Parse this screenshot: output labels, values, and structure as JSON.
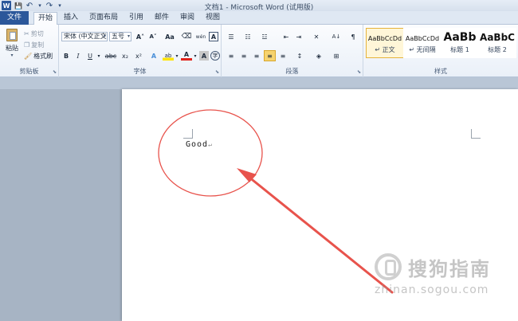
{
  "window": {
    "title": "文档1 - Microsoft Word (试用版)",
    "qat": {
      "logo": "W",
      "save": "💾",
      "undo": "↶",
      "redo": "↷",
      "customize": "▾"
    }
  },
  "tabs": [
    {
      "label": "文件"
    },
    {
      "label": "开始",
      "active": true
    },
    {
      "label": "插入"
    },
    {
      "label": "页面布局"
    },
    {
      "label": "引用"
    },
    {
      "label": "邮件"
    },
    {
      "label": "审阅"
    },
    {
      "label": "视图"
    }
  ],
  "ribbon": {
    "clipboard": {
      "label": "剪贴板",
      "paste": "粘贴",
      "cut": "剪切",
      "copy": "复制",
      "format_painter": "格式刷"
    },
    "font": {
      "label": "字体",
      "font_name": "宋体 (中文正文)",
      "font_size": "五号",
      "grow": "A˄",
      "shrink": "A˅",
      "change_case": "Aa",
      "clear_format": "🆎",
      "phonetic": "wén",
      "char_border": "A",
      "bold": "B",
      "italic": "I",
      "underline": "U",
      "strike": "abc",
      "subscript": "x₂",
      "superscript": "x²",
      "effects": "A",
      "highlight": "ab",
      "font_color": "A",
      "char_shading": "A",
      "enclose": "字"
    },
    "paragraph": {
      "label": "段落",
      "bullets": "☰",
      "numbering": "☷",
      "multilevel": "☳",
      "decrease_indent": "⇤",
      "increase_indent": "⇥",
      "chinese_layout": "✕",
      "sort": "A↓",
      "show_marks": "¶",
      "align_left": "≡",
      "center": "≡",
      "align_right": "≡",
      "justify": "≡",
      "distributed": "≡",
      "line_spacing": "↕",
      "shading": "◈",
      "borders": "⊞"
    },
    "styles": {
      "label": "样式",
      "items": [
        {
          "sample": "AaBbCcDd",
          "name": "↵ 正文",
          "selected": true
        },
        {
          "sample": "AaBbCcDd",
          "name": "↵ 无间隔"
        },
        {
          "sample": "AaBb",
          "name": "标题 1"
        },
        {
          "sample": "AaBbC",
          "name": "标题 2"
        }
      ]
    }
  },
  "document": {
    "text": "Good",
    "paragraph_mark": "↵"
  },
  "watermark": {
    "name": "搜狗指南",
    "url": "zhinan.sogou.com"
  },
  "colors": {
    "file_tab": "#2b579a",
    "annotation": "#e8534c",
    "selected_style": "#e6b33a"
  }
}
